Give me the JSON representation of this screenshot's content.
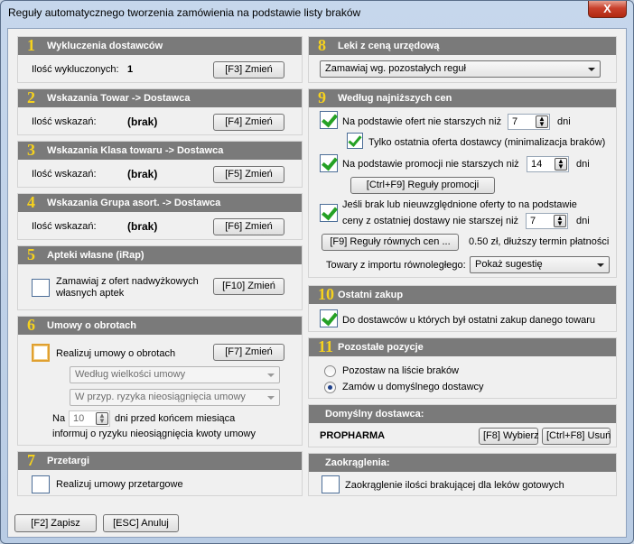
{
  "window": {
    "title": "Reguły automatycznego tworzenia zamówienia na podstawie listy braków",
    "close_label": "X"
  },
  "s1": {
    "num": "1",
    "title": "Wykluczenia dostawców",
    "label": "Ilość wykluczonych:",
    "value": "1",
    "button": "[F3] Zmień"
  },
  "s2": {
    "num": "2",
    "title": "Wskazania Towar -> Dostawca",
    "label": "Ilość wskazań:",
    "value": "(brak)",
    "button": "[F4] Zmień"
  },
  "s3": {
    "num": "3",
    "title": "Wskazania Klasa towaru -> Dostawca",
    "label": "Ilość wskazań:",
    "value": "(brak)",
    "button": "[F5] Zmień"
  },
  "s4": {
    "num": "4",
    "title": "Wskazania Grupa asort. -> Dostawca",
    "label": "Ilość wskazań:",
    "value": "(brak)",
    "button": "[F6] Zmień"
  },
  "s5": {
    "num": "5",
    "title": "Apteki własne (iRap)",
    "checkbox_label_1": "Zamawiaj z ofert nadwyżkowych",
    "checkbox_label_2": "własnych aptek",
    "button": "[F10] Zmień"
  },
  "s6": {
    "num": "6",
    "title": "Umowy o obrotach",
    "checkbox_label": "Realizuj umowy o obrotach",
    "button": "[F7] Zmień",
    "combo1": "Według wielkości umowy",
    "combo2": "W przyp. ryzyka nieosiągnięcia umowy",
    "na_label": "Na",
    "days_value": "10",
    "days_text": "dni przed końcem miesiąca",
    "inform_text": "informuj o ryzyku nieosiągnięcia kwoty umowy"
  },
  "s7": {
    "num": "7",
    "title": "Przetargi",
    "checkbox_label": "Realizuj umowy przetargowe"
  },
  "s8": {
    "num": "8",
    "title": "Leki z ceną urzędową",
    "combo": "Zamawiaj wg. pozostałych reguł"
  },
  "s9": {
    "num": "9",
    "title": "Według najniższych cen",
    "offers_label": "Na podstawie ofert nie starszych niż",
    "offers_value": "7",
    "offers_unit": "dni",
    "last_offer_label": "Tylko ostatnia oferta dostawcy (minimalizacja braków)",
    "promo_label": "Na podstawie promocji nie starszych niż",
    "promo_value": "14",
    "promo_unit": "dni",
    "promo_button": "[Ctrl+F9] Reguły promocji",
    "missing_label_1": "Jeśli brak lub nieuwzględnione oferty to na podstawie",
    "missing_label_2": "ceny z ostatniej dostawy nie starszej niż",
    "missing_value": "7",
    "missing_unit": "dni",
    "equal_button": "[F9] Reguły równych cen ...",
    "equal_text": "0.50 zł, dłuższy termin płatności",
    "import_label": "Towary z importu równoległego:",
    "import_combo": "Pokaż sugestię"
  },
  "s10": {
    "num": "10",
    "title": "Ostatni zakup",
    "checkbox_label": "Do dostawców u których był ostatni zakup danego towaru"
  },
  "s11": {
    "num": "11",
    "title": "Pozostałe pozycje",
    "radio1": "Pozostaw na liście braków",
    "radio2": "Zamów u domyślnego dostawcy"
  },
  "default_supplier": {
    "title": "Domyślny dostawca:",
    "name": "PROPHARMA",
    "choose_button": "[F8] Wybierz",
    "delete_button": "[Ctrl+F8] Usuń"
  },
  "rounding": {
    "title": "Zaokrąglenia:",
    "checkbox_label": "Zaokrąglenie ilości brakującej dla leków gotowych"
  },
  "footer": {
    "save_button": "[F2] Zapisz",
    "cancel_button": "[ESC] Anuluj"
  }
}
